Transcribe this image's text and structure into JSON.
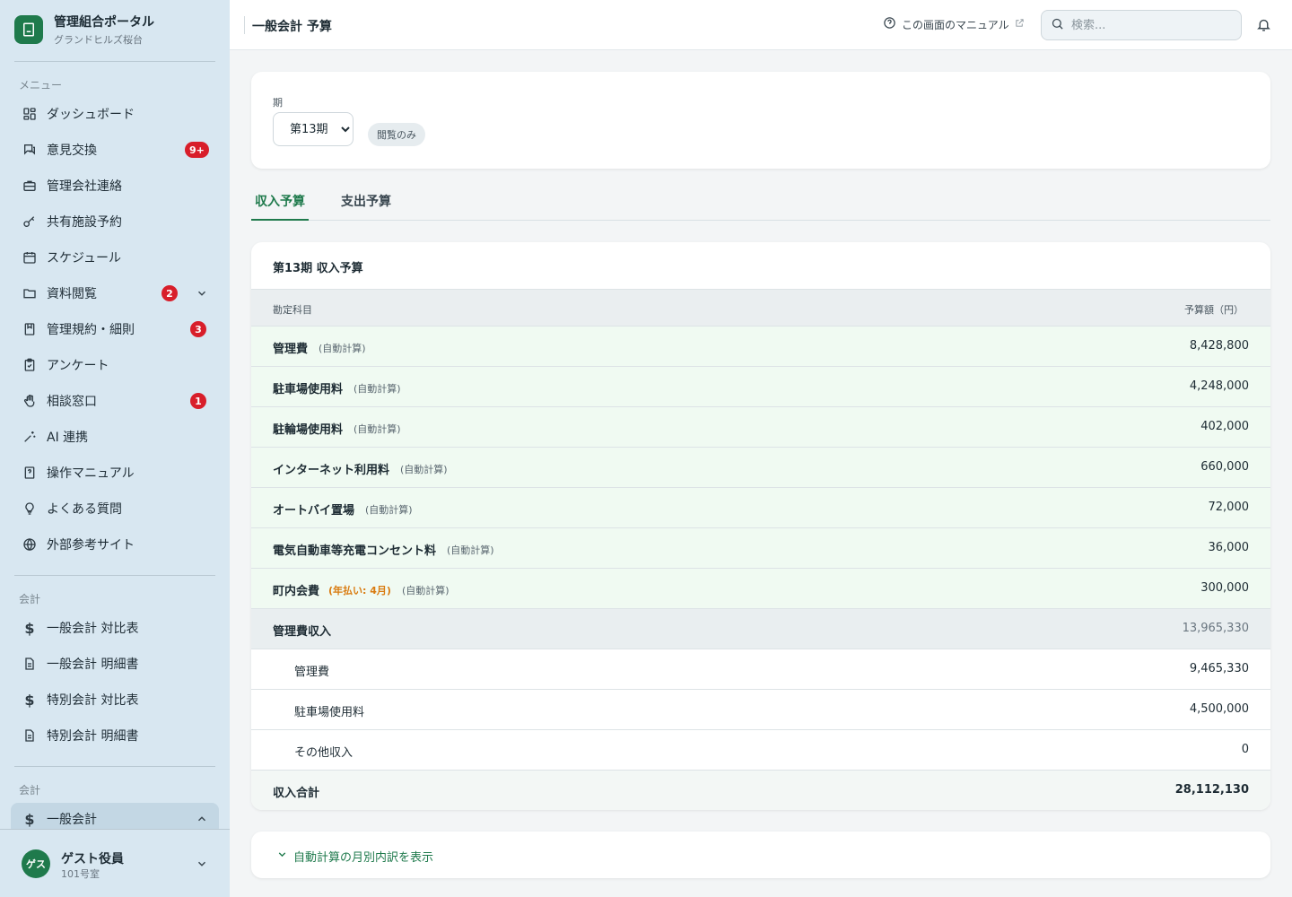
{
  "brand": {
    "title": "管理組合ポータル",
    "subtitle": "グランドヒルズ桜台"
  },
  "sidebar": {
    "menu_label": "メニュー",
    "items": [
      {
        "label": "ダッシュボード",
        "icon": "dashboard-icon"
      },
      {
        "label": "意見交換",
        "icon": "chat-icon",
        "badge": "9+"
      },
      {
        "label": "管理会社連絡",
        "icon": "briefcase-icon"
      },
      {
        "label": "共有施設予約",
        "icon": "key-icon"
      },
      {
        "label": "スケジュール",
        "icon": "calendar-icon"
      },
      {
        "label": "資料閲覧",
        "icon": "folder-icon",
        "badge": "2"
      },
      {
        "label": "管理規約・細則",
        "icon": "book-icon",
        "badge": "3"
      },
      {
        "label": "アンケート",
        "icon": "clipboard-icon"
      },
      {
        "label": "相談窓口",
        "icon": "hand-icon",
        "badge": "1"
      },
      {
        "label": "AI 連携",
        "icon": "sparkle-icon"
      },
      {
        "label": "操作マニュアル",
        "icon": "manual-icon"
      },
      {
        "label": "よくある質問",
        "icon": "lightbulb-icon"
      },
      {
        "label": "外部参考サイト",
        "icon": "globe-icon"
      }
    ],
    "accounting_label": "会計",
    "accounting_items": [
      {
        "label": "一般会計 対比表",
        "icon": "dollar-icon"
      },
      {
        "label": "一般会計 明細書",
        "icon": "document-icon"
      },
      {
        "label": "特別会計 対比表",
        "icon": "dollar-icon"
      },
      {
        "label": "特別会計 明細書",
        "icon": "document-icon"
      }
    ],
    "accounting2_label": "会計",
    "active_item": {
      "label": "一般会計",
      "icon": "dollar-icon"
    },
    "user": {
      "avatar": "ゲス",
      "name": "ゲスト役員",
      "room": "101号室"
    }
  },
  "topbar": {
    "title": "一般会計 予算",
    "manual_link": "この画面のマニュアル",
    "search_placeholder": "検索..."
  },
  "period": {
    "label": "期",
    "selected": "第13期",
    "readonly": "閲覧のみ"
  },
  "tabs": [
    {
      "label": "収入予算",
      "active": true
    },
    {
      "label": "支出予算",
      "active": false
    }
  ],
  "table": {
    "title": "第13期 収入予算",
    "col_account": "勘定科目",
    "col_amount": "予算額（円）",
    "auto_tag": "(自動計算)",
    "rows": [
      {
        "name": "管理費",
        "amount": "8,428,800"
      },
      {
        "name": "駐車場使用料",
        "amount": "4,248,000"
      },
      {
        "name": "駐輪場使用料",
        "amount": "402,000"
      },
      {
        "name": "インターネット利用料",
        "amount": "660,000"
      },
      {
        "name": "オートバイ置場",
        "amount": "72,000"
      },
      {
        "name": "電気自動車等充電コンセント料",
        "amount": "36,000"
      },
      {
        "name": "町内会費",
        "note": "(年払い: 4月)",
        "amount": "300,000"
      }
    ],
    "subtotal": {
      "name": "管理費収入",
      "amount": "13,965,330"
    },
    "children": [
      {
        "name": "管理費",
        "amount": "9,465,330"
      },
      {
        "name": "駐車場使用料",
        "amount": "4,500,000"
      },
      {
        "name": "その他収入",
        "amount": "0"
      }
    ],
    "total": {
      "name": "収入合計",
      "amount": "28,112,130"
    }
  },
  "expand_label": "自動計算の月別内訳を表示",
  "colors": {
    "accent": "#1f7a4c",
    "badge": "#d81e2a",
    "sidebar_bg": "#d8e7f1",
    "auto_row": "#f0faf2",
    "note_orange": "#d97b10"
  }
}
